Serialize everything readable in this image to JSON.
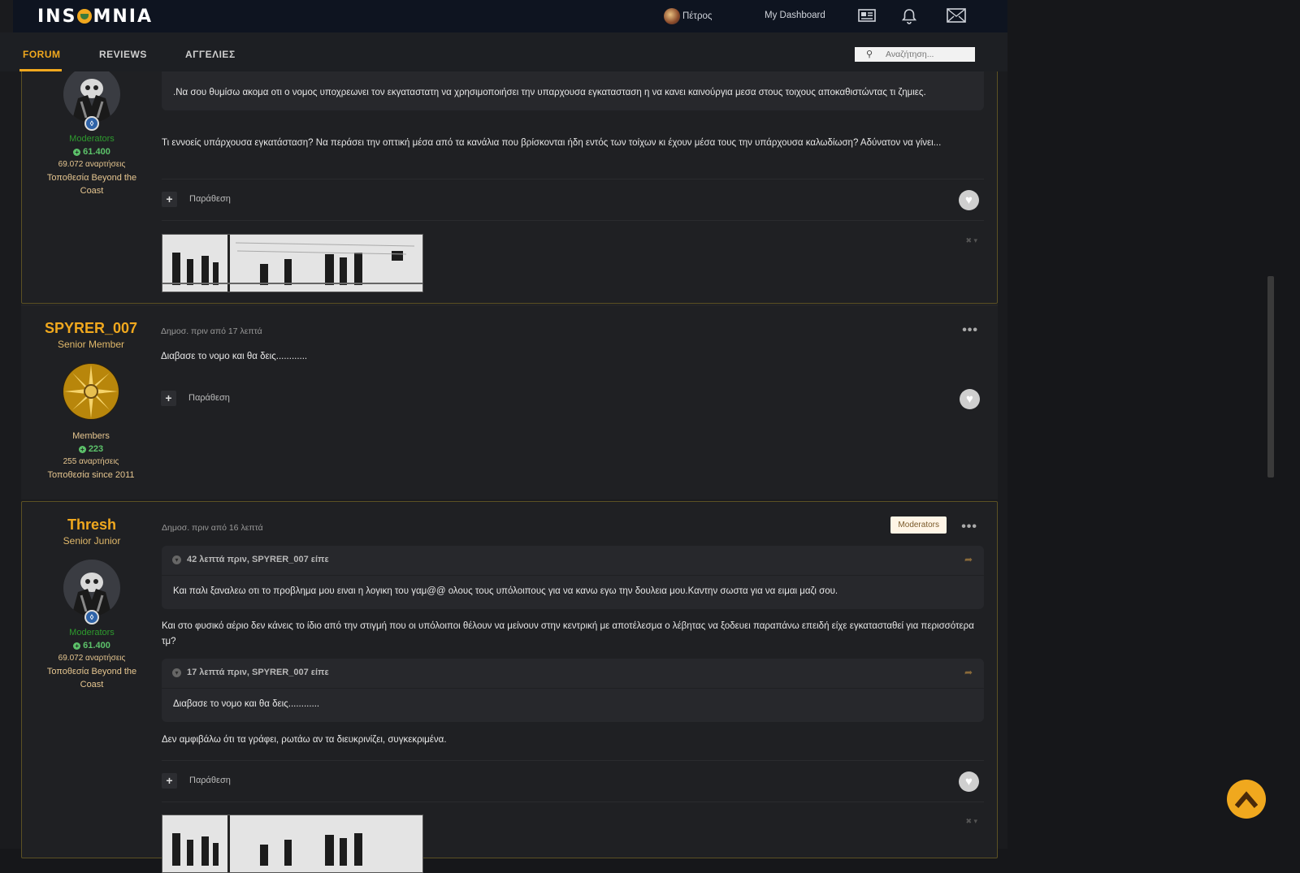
{
  "header": {
    "logo": "INSOMNIA",
    "user_name": "Πέτρος",
    "dashboard": "My Dashboard",
    "icons": [
      "news-icon",
      "bell-icon",
      "mail-icon"
    ]
  },
  "nav": {
    "tabs": [
      {
        "label": "FORUM",
        "active": true
      },
      {
        "label": "REVIEWS",
        "active": false
      },
      {
        "label": "ΑΓΓΕΛΙΕΣ",
        "active": false
      }
    ],
    "search_placeholder": "Αναζήτηση..."
  },
  "post1": {
    "group": "Moderators",
    "reputation": "61.400",
    "posts": "69.072 αναρτήσεις",
    "location": "Τοποθεσία Beyond the Coast",
    "quote_text": ".Να σου θυμίσω ακομα οτι ο νομος υποχρεωνει τον εκγαταστατη να χρησιμοποιήσει  την υπαρχουσα εγκατασταση η  να κανει καινούργια μεσα στους τοιχους αποκαθιστώντας τι ζημιες.",
    "body": "Τι εννοείς υπάρχουσα εγκατάσταση? Να περάσει την οπτική μέσα από τα κανάλια που βρίσκονται ήδη εντός των τοίχων κι έχουν μέσα τους την υπάρχουσα καλωδίωση? Αδύνατον να γίνει...",
    "quote_button": "Παράθεση"
  },
  "post2": {
    "author": "SPYRER_007",
    "title": "Senior Member",
    "group": "Members",
    "reputation": "223",
    "posts": "255 αναρτήσεις",
    "location": "Τοποθεσία since 2011",
    "meta": "Δημοσ. πριν από 17 λεπτά",
    "body": "Διαβασε το νομο και θα δεις............",
    "quote_button": "Παράθεση"
  },
  "post3": {
    "author": "Thresh",
    "title": "Senior Junior",
    "group": "Moderators",
    "reputation": "61.400",
    "posts": "69.072 αναρτήσεις",
    "location": "Τοποθεσία Beyond the Coast",
    "meta": "Δημοσ. πριν από 16 λεπτά",
    "badge": "Moderators",
    "quote1_head": "42 λεπτά πριν, SPYRER_007 είπε",
    "quote1_text": "Και παλι ξαναλεω οτι το προβλημα μου ειναι η λογικη του γαμ@@ ολους τους υπόλοιπους για να κανω εγω την δουλεια μου.Καντην σωστα για να  ειμαι μαζι σου.",
    "body1": "Και στο φυσικό αέριο δεν κάνεις το ίδιο από την στιγμή που οι υπόλοιποι θέλουν να μείνουν στην κεντρική με αποτέλεσμα ο λέβητας να ξοδευει παραπάνω επειδή είχε εγκατασταθεί για περισσότερα τμ?",
    "quote2_head": "17 λεπτά πριν, SPYRER_007 είπε",
    "quote2_text": "Διαβασε το νομο και θα δεις............",
    "body2": "Δεν αμφιβάλω ότι τα γράφει, ρωτάω αν τα διευκρινίζει, συγκεκριμένα.",
    "quote_button": "Παράθεση"
  },
  "colors": {
    "accent": "#f0a81e",
    "reputation": "#5cc26a",
    "moderator_group": "#2e9a2e"
  }
}
